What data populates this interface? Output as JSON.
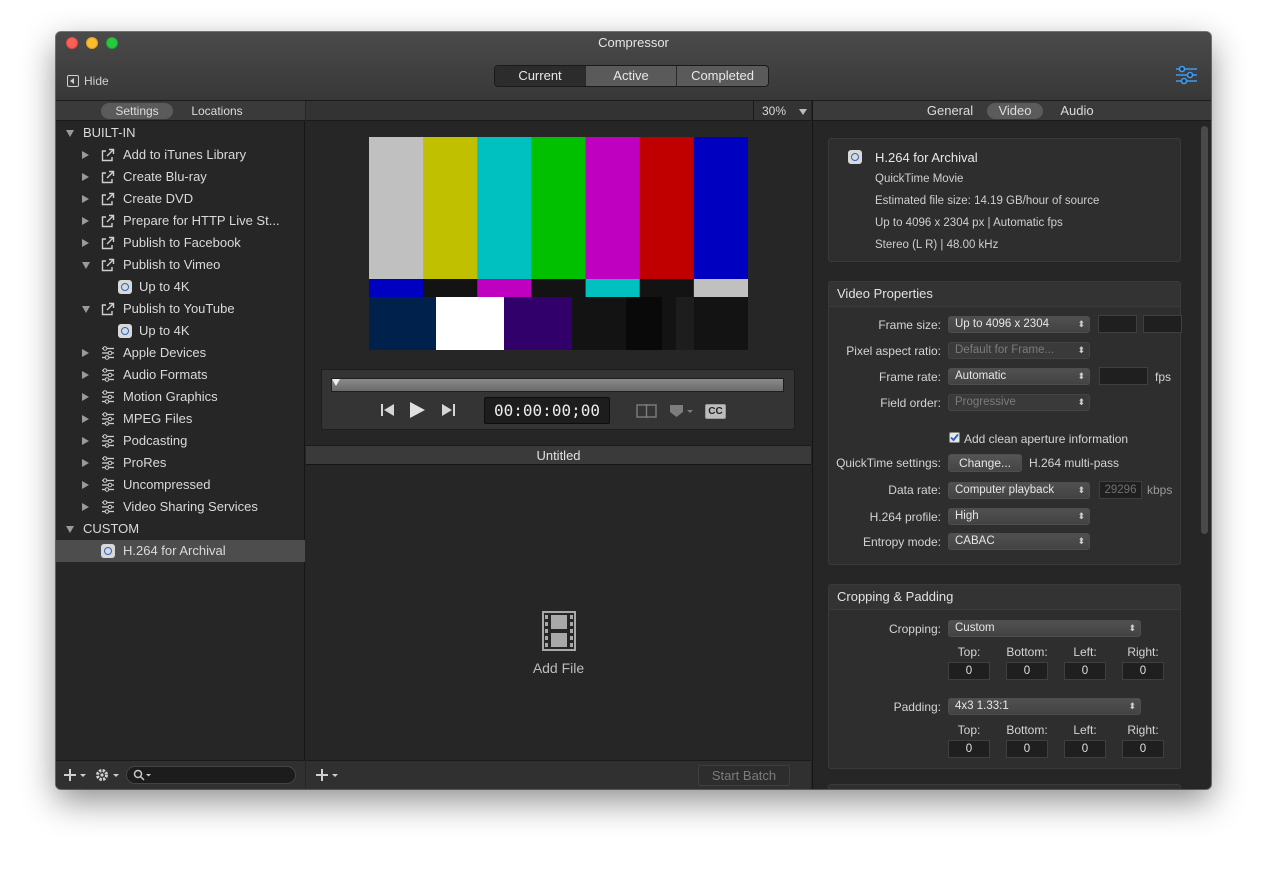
{
  "window": {
    "title": "Compressor",
    "hide_label": "Hide"
  },
  "main_tabs": [
    {
      "label": "Current",
      "selected": true
    },
    {
      "label": "Active",
      "selected": false
    },
    {
      "label": "Completed",
      "selected": false
    }
  ],
  "sidebar": {
    "tabs": [
      {
        "label": "Settings",
        "selected": true
      },
      {
        "label": "Locations",
        "selected": false
      }
    ],
    "tree": [
      {
        "label": "BUILT-IN",
        "level": 0,
        "disclosure": "down",
        "icon": "none"
      },
      {
        "label": "Add to iTunes Library",
        "level": 1,
        "disclosure": "right",
        "icon": "share-icon"
      },
      {
        "label": "Create Blu-ray",
        "level": 1,
        "disclosure": "right",
        "icon": "share-icon"
      },
      {
        "label": "Create DVD",
        "level": 1,
        "disclosure": "right",
        "icon": "share-icon"
      },
      {
        "label": "Prepare for HTTP Live St...",
        "level": 1,
        "disclosure": "right",
        "icon": "share-icon"
      },
      {
        "label": "Publish to Facebook",
        "level": 1,
        "disclosure": "right",
        "icon": "share-icon"
      },
      {
        "label": "Publish to Vimeo",
        "level": 1,
        "disclosure": "down",
        "icon": "share-icon"
      },
      {
        "label": "Up to 4K",
        "level": 2,
        "disclosure": "none",
        "icon": "quicktime-icon"
      },
      {
        "label": "Publish to YouTube",
        "level": 1,
        "disclosure": "down",
        "icon": "share-icon"
      },
      {
        "label": "Up to 4K",
        "level": 2,
        "disclosure": "none",
        "icon": "quicktime-icon"
      },
      {
        "label": "Apple Devices",
        "level": 1,
        "disclosure": "right",
        "icon": "settings-group-icon"
      },
      {
        "label": "Audio Formats",
        "level": 1,
        "disclosure": "right",
        "icon": "settings-group-icon"
      },
      {
        "label": "Motion Graphics",
        "level": 1,
        "disclosure": "right",
        "icon": "settings-group-icon"
      },
      {
        "label": "MPEG Files",
        "level": 1,
        "disclosure": "right",
        "icon": "settings-group-icon"
      },
      {
        "label": "Podcasting",
        "level": 1,
        "disclosure": "right",
        "icon": "settings-group-icon"
      },
      {
        "label": "ProRes",
        "level": 1,
        "disclosure": "right",
        "icon": "settings-group-icon"
      },
      {
        "label": "Uncompressed",
        "level": 1,
        "disclosure": "right",
        "icon": "settings-group-icon"
      },
      {
        "label": "Video Sharing Services",
        "level": 1,
        "disclosure": "right",
        "icon": "settings-group-icon"
      },
      {
        "label": "CUSTOM",
        "level": 0,
        "disclosure": "down",
        "icon": "none"
      },
      {
        "label": "H.264 for Archival",
        "level": 1,
        "disclosure": "none",
        "icon": "quicktime-icon",
        "selected": true
      }
    ]
  },
  "viewer": {
    "zoom": "30%",
    "timecode": "00:00:00;00",
    "playhead_fraction": 0.0,
    "cc_label": "CC",
    "colors": {
      "top": [
        "#c0c0c0",
        "#c0c000",
        "#00c0c0",
        "#00c000",
        "#c000c0",
        "#c00000",
        "#0000c0"
      ],
      "mid": [
        "#0000c0",
        "#131313",
        "#c000c0",
        "#131313",
        "#00c0c0",
        "#131313",
        "#c0c0c0"
      ],
      "bottom": [
        "#00214c",
        "#ffffff",
        "#32006a",
        "#131313",
        "#090909",
        "#131313",
        "#1d1d1d",
        "#131313"
      ]
    }
  },
  "batch": {
    "title": "Untitled",
    "add_file_label": "Add File",
    "start_batch_label": "Start Batch"
  },
  "inspector": {
    "tabs": [
      {
        "label": "General",
        "selected": false
      },
      {
        "label": "Video",
        "selected": true
      },
      {
        "label": "Audio",
        "selected": false
      }
    ],
    "summary": {
      "name": "H.264 for Archival",
      "lines": [
        "QuickTime Movie",
        "Estimated file size: 14.19 GB/hour of source",
        "Up to 4096 x 2304 px | Automatic fps",
        "Stereo (L R) | 48.00 kHz"
      ]
    },
    "video_properties": {
      "title": "Video Properties",
      "frame_size_label": "Frame size:",
      "frame_size_value": "Up to 4096 x 2304",
      "pixel_aspect_label": "Pixel aspect ratio:",
      "pixel_aspect_value": "Default for Frame...",
      "frame_rate_label": "Frame rate:",
      "frame_rate_value": "Automatic",
      "fps_label": "fps",
      "field_order_label": "Field order:",
      "field_order_value": "Progressive",
      "clean_aperture_label": "Add clean aperture information",
      "clean_aperture_checked": true,
      "qt_settings_label": "QuickTime settings:",
      "qt_change_label": "Change...",
      "qt_settings_value": "H.264 multi-pass",
      "data_rate_label": "Data rate:",
      "data_rate_value": "Computer playback",
      "data_rate_number": "29296",
      "data_rate_unit": "kbps",
      "h264_profile_label": "H.264 profile:",
      "h264_profile_value": "High",
      "entropy_label": "Entropy mode:",
      "entropy_value": "CABAC"
    },
    "cropping": {
      "title": "Cropping & Padding",
      "cropping_label": "Cropping:",
      "cropping_value": "Custom",
      "padding_label": "Padding:",
      "padding_value": "4x3 1.33:1",
      "top_label": "Top:",
      "bottom_label": "Bottom:",
      "left_label": "Left:",
      "right_label": "Right:",
      "crop_values": [
        "0",
        "0",
        "0",
        "0"
      ],
      "pad_values": [
        "0",
        "0",
        "0",
        "0"
      ]
    }
  }
}
